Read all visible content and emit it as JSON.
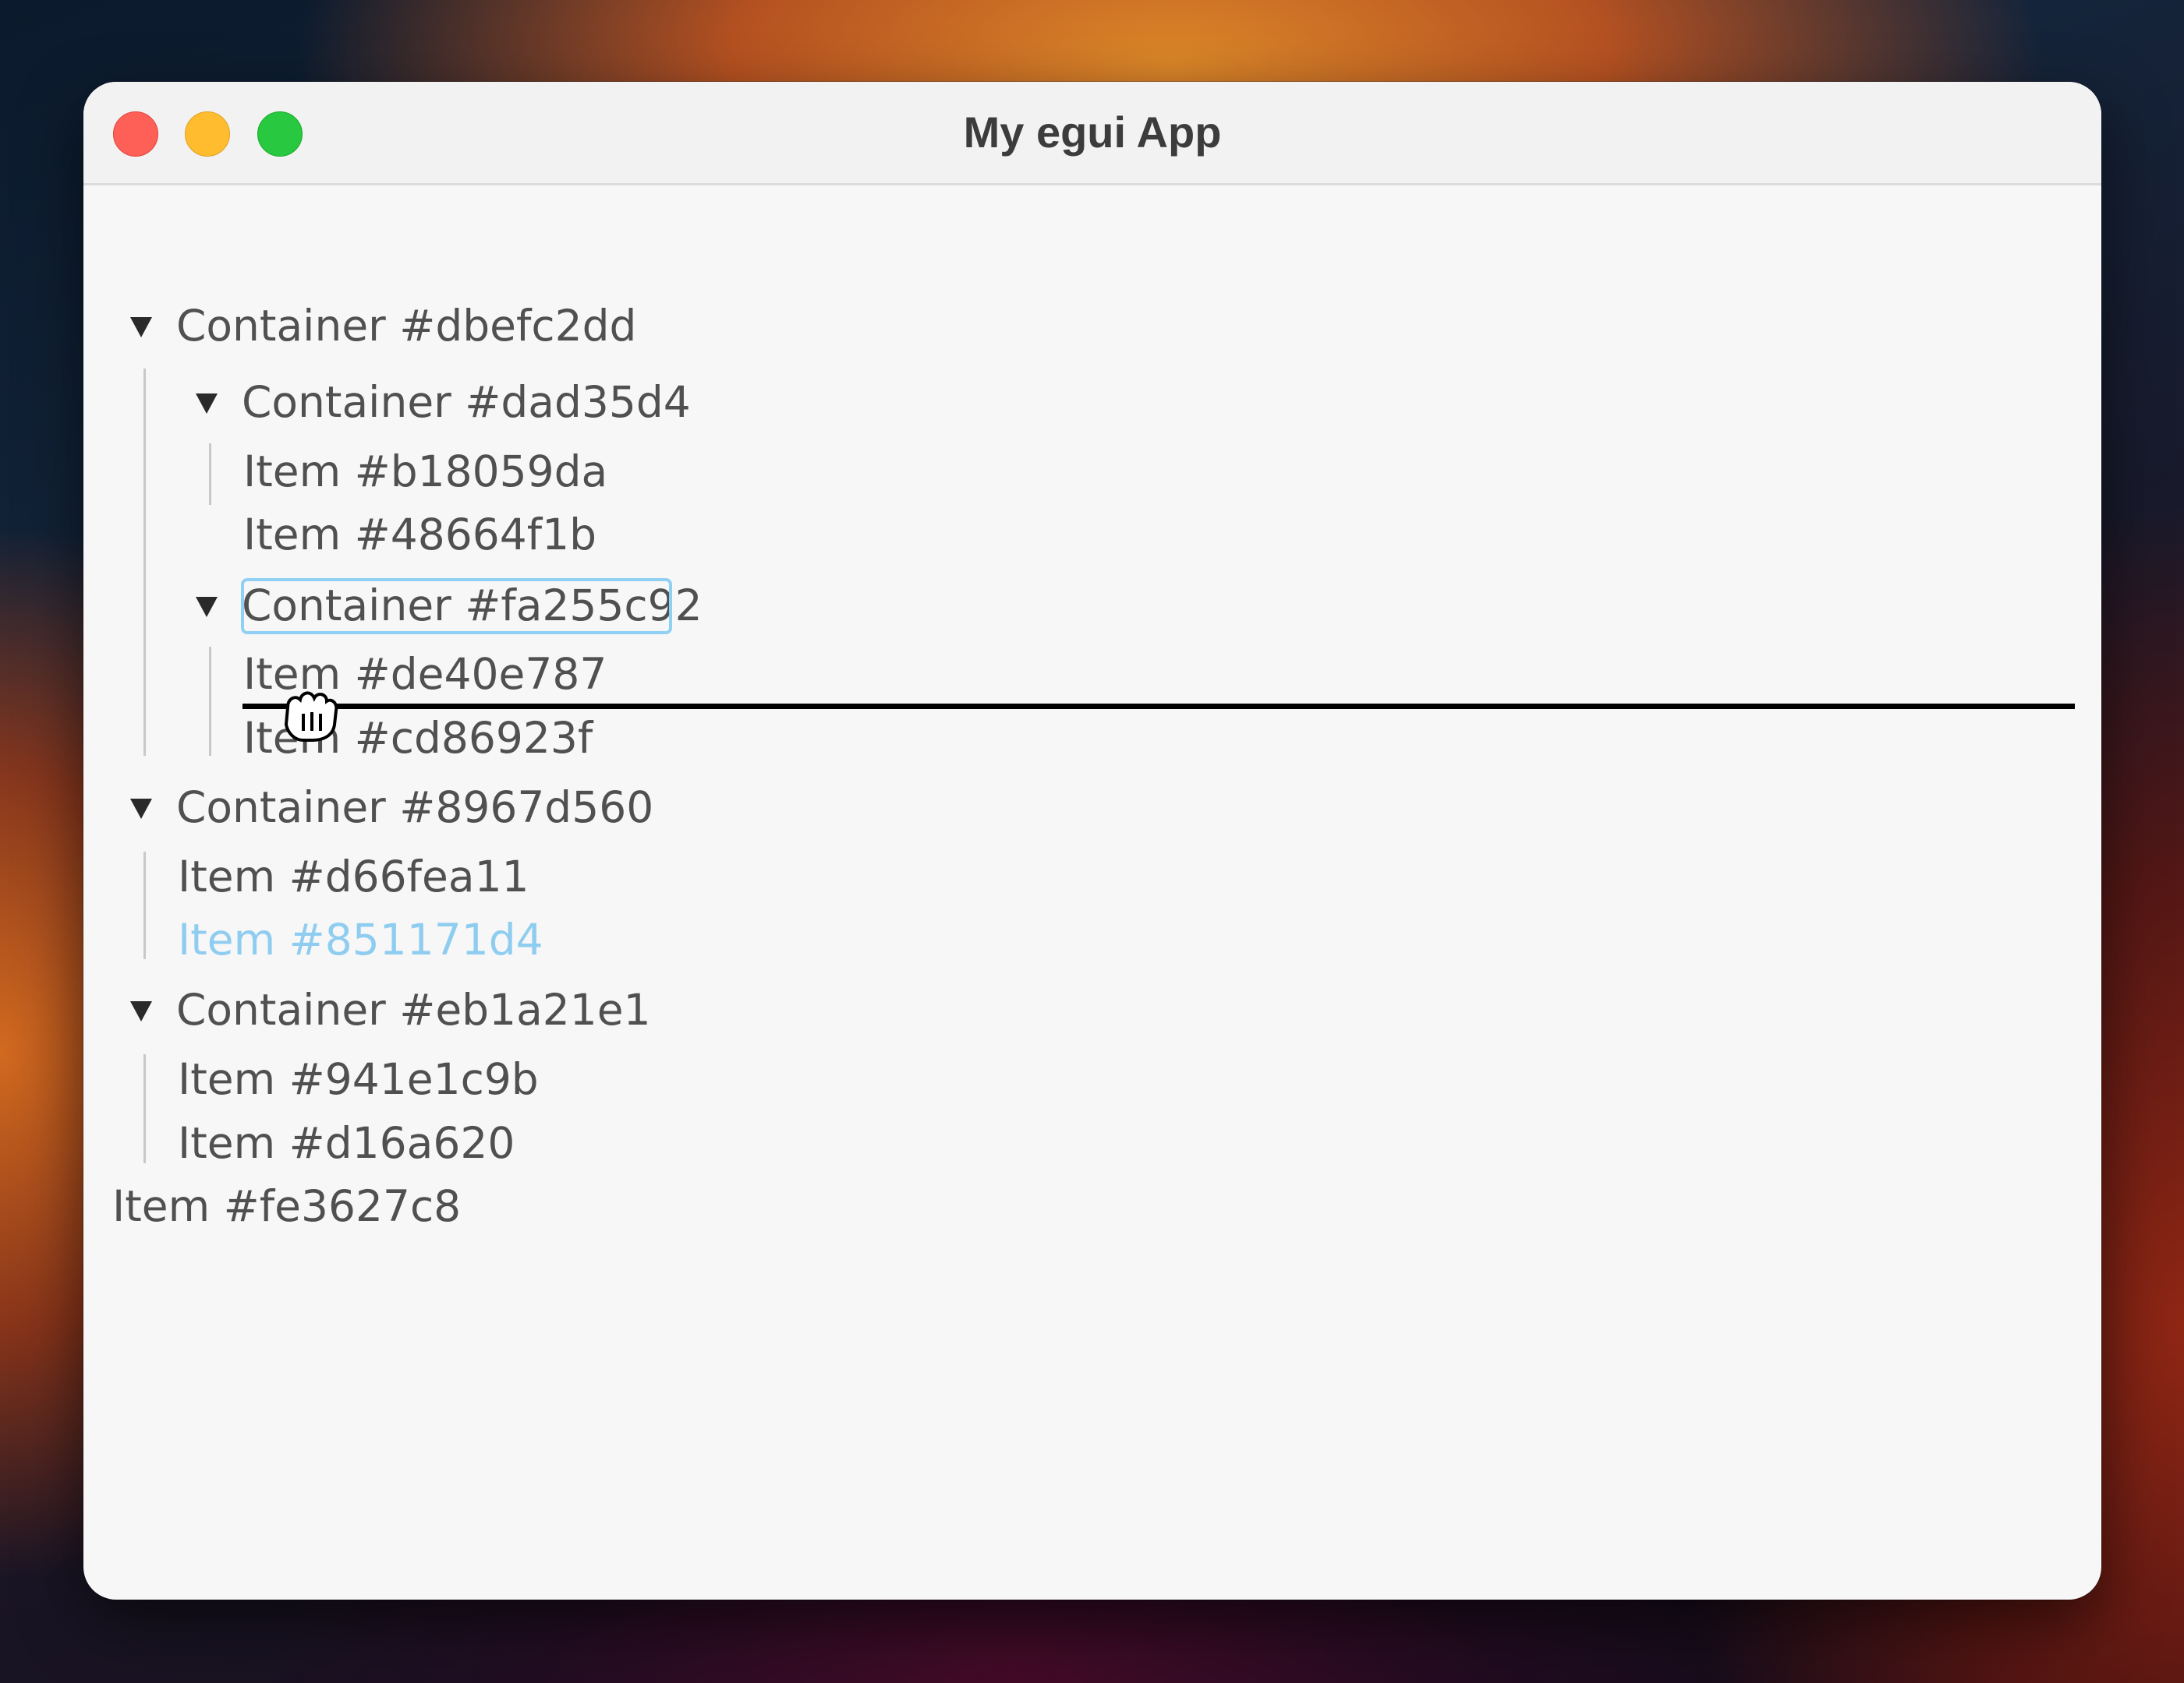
{
  "window": {
    "title": "My egui App"
  },
  "tree": {
    "c1": {
      "label": "Container #dbefc2dd"
    },
    "c1a": {
      "label": "Container #dad35d4"
    },
    "i1": {
      "label": "Item #b18059da"
    },
    "i2": {
      "label": "Item #48664f1b"
    },
    "c1b": {
      "label": "Container #fa255c92"
    },
    "i3": {
      "label": "Item #de40e787"
    },
    "i4": {
      "label": "Item #cd86923f"
    },
    "c2": {
      "label": "Container #8967d560"
    },
    "i5": {
      "label": "Item #d66fea11"
    },
    "i6": {
      "label": "Item #851171d4"
    },
    "c3": {
      "label": "Container #eb1a21e1"
    },
    "i7": {
      "label": "Item #941e1c9b"
    },
    "i8": {
      "label": "Item #d16a620"
    },
    "i9": {
      "label": "Item #fe3627c8"
    }
  },
  "colors": {
    "highlight_text": "#8fcdf0",
    "focus_outline": "#90d0f4",
    "drop_indicator": "#000000"
  },
  "cursor": {
    "icon": "grab-hand-icon"
  }
}
